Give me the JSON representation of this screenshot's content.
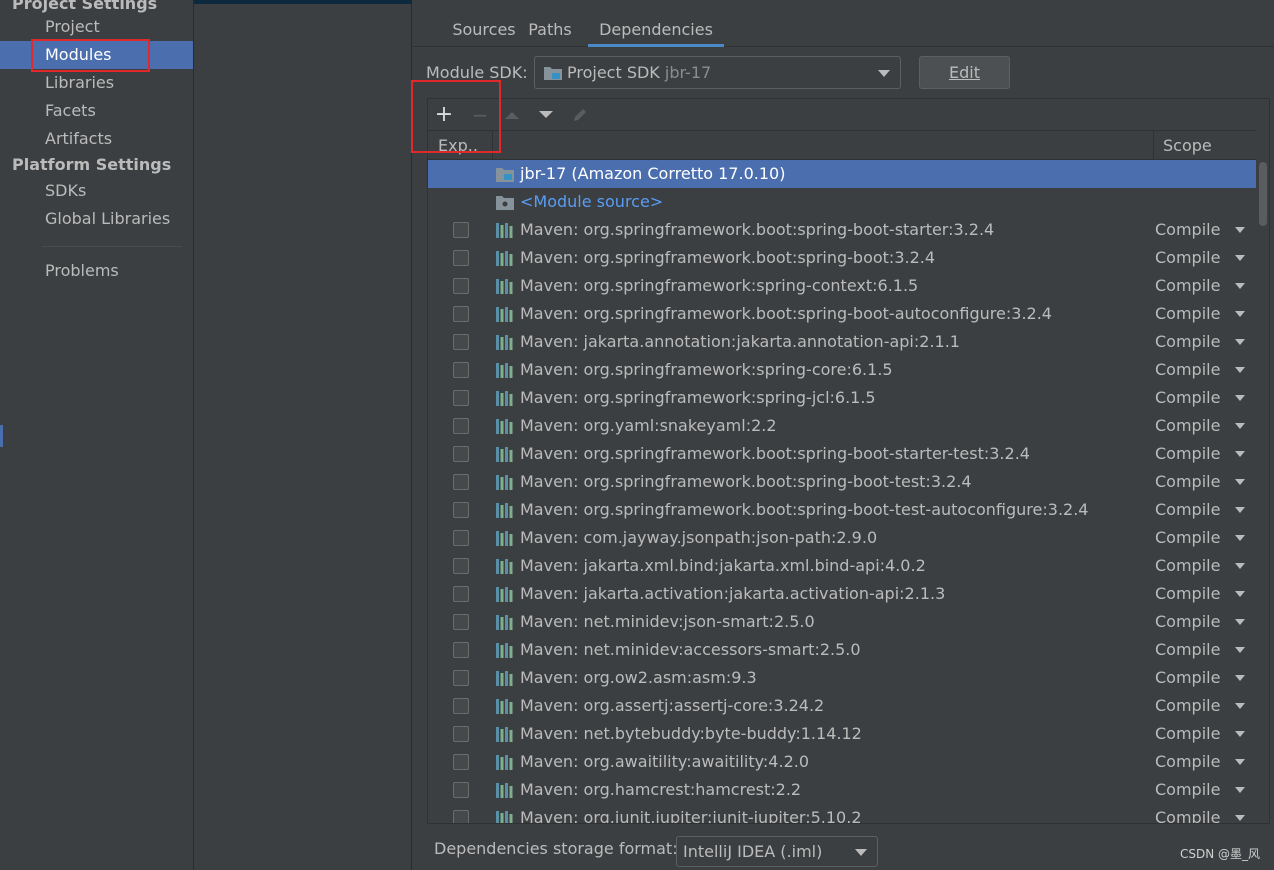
{
  "left_panel": {
    "project_settings_heading": "Project Settings",
    "platform_settings_heading": "Platform Settings",
    "items": [
      {
        "label": "Project"
      },
      {
        "label": "Modules"
      },
      {
        "label": "Libraries"
      },
      {
        "label": "Facets"
      },
      {
        "label": "Artifacts"
      },
      {
        "label": "SDKs"
      },
      {
        "label": "Global Libraries"
      },
      {
        "label": "Problems"
      }
    ],
    "selected": "Modules"
  },
  "tabs": [
    {
      "label": "Sources"
    },
    {
      "label": "Paths"
    },
    {
      "label": "Dependencies"
    }
  ],
  "active_tab": "Dependencies",
  "module_sdk": {
    "label": "Module SDK:",
    "value": "Project SDK",
    "value_dim": "jbr-17",
    "edit_label": "Edit"
  },
  "toolbar": {
    "add_glyph": "+",
    "remove_glyph": "−",
    "up_icon": "triangle-up-icon",
    "down_icon": "triangle-down-icon",
    "edit_icon": "pencil-icon"
  },
  "table": {
    "headers": {
      "export": "Exp..",
      "scope": "Scope"
    },
    "sdk_row": "jbr-17 (Amazon Corretto 17.0.10)",
    "module_source_row": "<Module source>",
    "rows": [
      {
        "name": "Maven: org.springframework.boot:spring-boot-starter:3.2.4",
        "scope": "Compile"
      },
      {
        "name": "Maven: org.springframework.boot:spring-boot:3.2.4",
        "scope": "Compile"
      },
      {
        "name": "Maven: org.springframework:spring-context:6.1.5",
        "scope": "Compile"
      },
      {
        "name": "Maven: org.springframework.boot:spring-boot-autoconfigure:3.2.4",
        "scope": "Compile"
      },
      {
        "name": "Maven: jakarta.annotation:jakarta.annotation-api:2.1.1",
        "scope": "Compile"
      },
      {
        "name": "Maven: org.springframework:spring-core:6.1.5",
        "scope": "Compile"
      },
      {
        "name": "Maven: org.springframework:spring-jcl:6.1.5",
        "scope": "Compile"
      },
      {
        "name": "Maven: org.yaml:snakeyaml:2.2",
        "scope": "Compile"
      },
      {
        "name": "Maven: org.springframework.boot:spring-boot-starter-test:3.2.4",
        "scope": "Compile"
      },
      {
        "name": "Maven: org.springframework.boot:spring-boot-test:3.2.4",
        "scope": "Compile"
      },
      {
        "name": "Maven: org.springframework.boot:spring-boot-test-autoconfigure:3.2.4",
        "scope": "Compile"
      },
      {
        "name": "Maven: com.jayway.jsonpath:json-path:2.9.0",
        "scope": "Compile"
      },
      {
        "name": "Maven: jakarta.xml.bind:jakarta.xml.bind-api:4.0.2",
        "scope": "Compile"
      },
      {
        "name": "Maven: jakarta.activation:jakarta.activation-api:2.1.3",
        "scope": "Compile"
      },
      {
        "name": "Maven: net.minidev:json-smart:2.5.0",
        "scope": "Compile"
      },
      {
        "name": "Maven: net.minidev:accessors-smart:2.5.0",
        "scope": "Compile"
      },
      {
        "name": "Maven: org.ow2.asm:asm:9.3",
        "scope": "Compile"
      },
      {
        "name": "Maven: org.assertj:assertj-core:3.24.2",
        "scope": "Compile"
      },
      {
        "name": "Maven: net.bytebuddy:byte-buddy:1.14.12",
        "scope": "Compile"
      },
      {
        "name": "Maven: org.awaitility:awaitility:4.2.0",
        "scope": "Compile"
      },
      {
        "name": "Maven: org.hamcrest:hamcrest:2.2",
        "scope": "Compile"
      },
      {
        "name": "Maven: org.junit.jupiter:junit-jupiter:5.10.2",
        "scope": "Compile"
      }
    ]
  },
  "storage_format": {
    "label": "Dependencies storage format:",
    "value": "IntelliJ IDEA (.iml)"
  },
  "watermark": "CSDN @墨_风",
  "colors": {
    "background": "#3c3f41",
    "selection": "#4b6eaf",
    "link": "#589df6",
    "highlight_box": "#e1282a",
    "tab_underline": "#4a88c7"
  }
}
